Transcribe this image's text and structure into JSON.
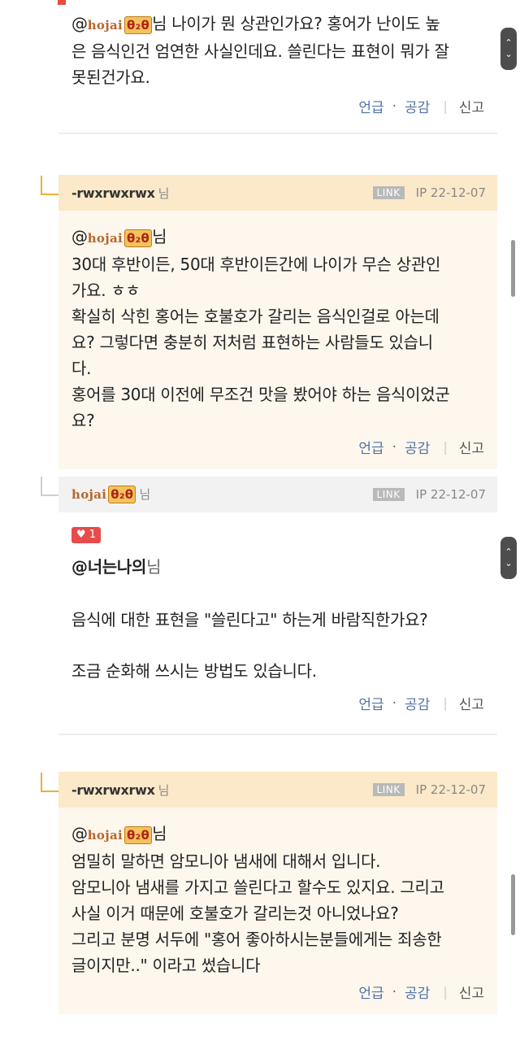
{
  "partial_top": {
    "mention_user": "hojai",
    "mention_logo": "θ₂θ",
    "lines": [
      "님 나이가 뭔 상관인가요? 홍어가 난이도 높",
      "은 음식인건 엄연한 사실인데요. 쓸린다는 표현이 뭐가 잘",
      "못된건가요."
    ]
  },
  "actions": {
    "mention": "언급",
    "dot": "·",
    "like": "공감",
    "sep": "|",
    "report": "신고"
  },
  "badge": {
    "link": "LINK"
  },
  "comments": [
    {
      "author": "-rwxrwxrwx",
      "suffix": "님",
      "ip": "IP",
      "date": "22-12-07",
      "mention_user": "hojai",
      "mention_logo": "θ₂θ",
      "mention_suffix": "님",
      "lines": [
        "30대 후반이든, 50대 후반이든간에 나이가 무슨 상관인",
        "가요. ㅎㅎ",
        "확실히 삭힌 홍어는 호불호가 갈리는 음식인걸로 아는데",
        "요? 그렇다면 충분히 저처럼 표현하는 사람들도 있습니",
        "다.",
        "홍어를 30대 이전에 무조건 맛을 봤어야 하는 음식이었군",
        "요?"
      ]
    },
    {
      "author": "hojai",
      "author_logo": "θ₂θ",
      "suffix": "님",
      "ip": "IP",
      "date": "22-12-07",
      "likes": "1",
      "mention": "@너는나의",
      "mention_suffix": "님",
      "para1": "음식에 대한 표현을 \"쓸린다고\" 하는게 바람직한가요?",
      "para2": "조금 순화해 쓰시는 방법도 있습니다."
    },
    {
      "author": "-rwxrwxrwx",
      "suffix": "님",
      "ip": "IP",
      "date": "22-12-07",
      "mention_user": "hojai",
      "mention_logo": "θ₂θ",
      "mention_suffix": "님",
      "lines": [
        "엄밀히 말하면 암모니아 냄새에 대해서 입니다.",
        "암모니아 냄새를 가지고 쓸린다고 할수도 있지요. 그리고",
        "사실 이거 때문에 호불호가 갈리는것 아니었나요?",
        "그리고 분명 서두에 \"홍어 좋아하시는분들에게는 죄송한",
        "글이지만..\" 이라고 썼습니다"
      ]
    }
  ],
  "colors": {
    "reply_bg": "#fdf7ee",
    "reply_header": "#fbe9c9",
    "gray_header": "#f2f2f2",
    "action_blue": "#5173a6",
    "elbow": "#e8b13a",
    "heart": "#e94a4a"
  },
  "icons": {
    "scroll": "chevron-up-down-icon",
    "heart": "heart-icon"
  }
}
